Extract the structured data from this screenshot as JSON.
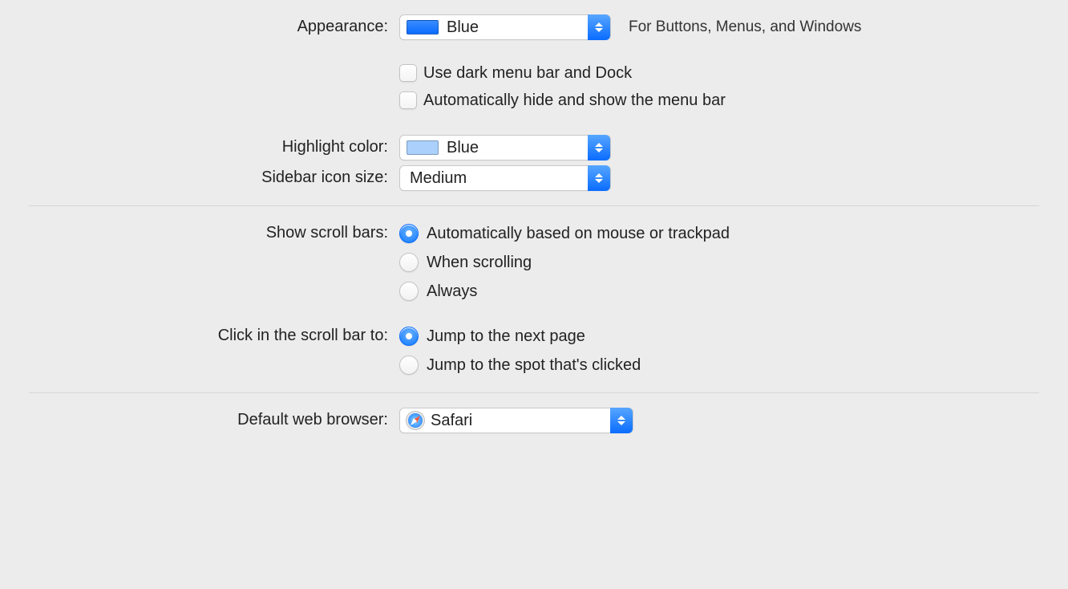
{
  "appearance": {
    "label": "Appearance:",
    "value": "Blue",
    "hint": "For Buttons, Menus, and Windows",
    "swatch_color": "#1279ff",
    "checkboxes": {
      "dark_menu": {
        "label": "Use dark menu bar and Dock",
        "checked": false
      },
      "auto_hide": {
        "label": "Automatically hide and show the menu bar",
        "checked": false
      }
    }
  },
  "highlight": {
    "label": "Highlight color:",
    "value": "Blue",
    "swatch_color": "#aad0fb"
  },
  "sidebar": {
    "label": "Sidebar icon size:",
    "value": "Medium"
  },
  "scrollbars": {
    "label": "Show scroll bars:",
    "options": [
      {
        "label": "Automatically based on mouse or trackpad",
        "selected": true
      },
      {
        "label": "When scrolling",
        "selected": false
      },
      {
        "label": "Always",
        "selected": false
      }
    ]
  },
  "click_scroll": {
    "label": "Click in the scroll bar to:",
    "options": [
      {
        "label": "Jump to the next page",
        "selected": true
      },
      {
        "label": "Jump to the spot that's clicked",
        "selected": false
      }
    ]
  },
  "browser": {
    "label": "Default web browser:",
    "value": "Safari"
  }
}
